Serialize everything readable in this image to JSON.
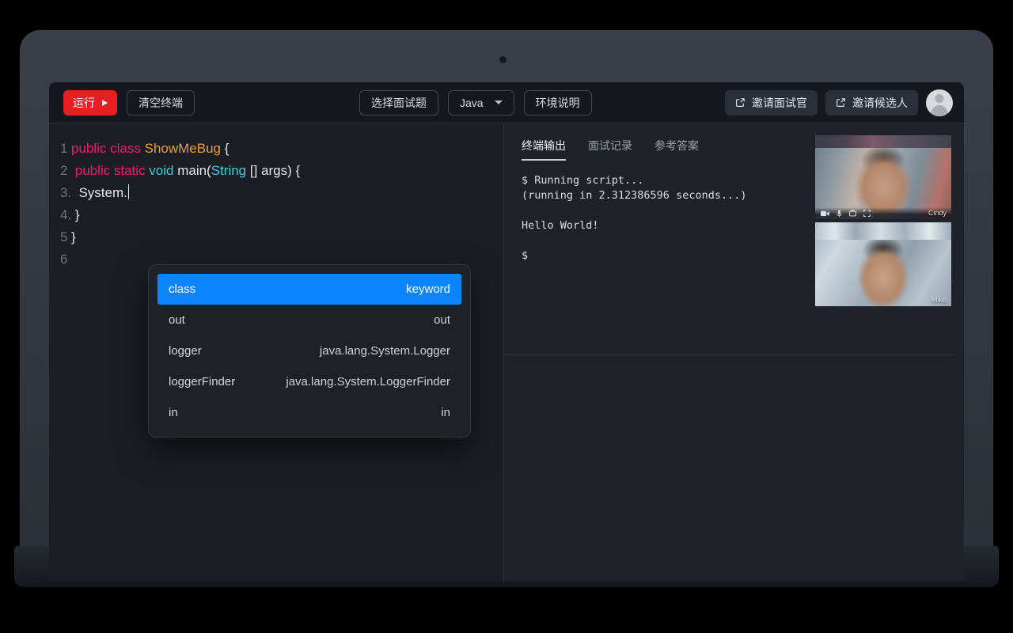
{
  "toolbar": {
    "run_label": "运行",
    "clear_terminal_label": "清空终端",
    "select_question_label": "选择面试题",
    "language_value": "Java",
    "env_note_label": "环境说明",
    "invite_interviewer_label": "邀请面试官",
    "invite_candidate_label": "邀请候选人"
  },
  "editor": {
    "lines": [
      {
        "no": "1",
        "tokens": [
          {
            "t": "public ",
            "c": "k-pink"
          },
          {
            "t": "class ",
            "c": "k-pink"
          },
          {
            "t": "ShowMeBug ",
            "c": "k-orange"
          },
          {
            "t": "{",
            "c": "ctext"
          }
        ]
      },
      {
        "no": "2",
        "tokens": [
          {
            "t": " ",
            "c": "ctext"
          },
          {
            "t": "public ",
            "c": "k-pink"
          },
          {
            "t": "static ",
            "c": "k-pink"
          },
          {
            "t": "void ",
            "c": "k-cyan"
          },
          {
            "t": "main(",
            "c": "ctext"
          },
          {
            "t": "String",
            "c": "k-cyan"
          },
          {
            "t": " [] args) {",
            "c": "ctext"
          }
        ]
      },
      {
        "no": "3.",
        "tokens": [
          {
            "t": "  System.",
            "c": "ctext"
          }
        ],
        "caret": true
      },
      {
        "no": "4.",
        "tokens": [
          {
            "t": " }",
            "c": "ctext"
          }
        ]
      },
      {
        "no": "5",
        "tokens": [
          {
            "t": "}",
            "c": "ctext"
          }
        ]
      },
      {
        "no": "6",
        "tokens": []
      }
    ]
  },
  "autocomplete": {
    "items": [
      {
        "label": "class",
        "detail": "keyword",
        "selected": true
      },
      {
        "label": "out",
        "detail": "out",
        "selected": false
      },
      {
        "label": "logger",
        "detail": "java.lang.System.Logger",
        "selected": false
      },
      {
        "label": "loggerFinder",
        "detail": "java.lang.System.LoggerFinder",
        "selected": false
      },
      {
        "label": "in",
        "detail": "in",
        "selected": false
      }
    ]
  },
  "right_panel": {
    "tabs": [
      {
        "label": "终端输出",
        "active": true
      },
      {
        "label": "面试记录",
        "active": false
      },
      {
        "label": "参考答案",
        "active": false
      }
    ],
    "terminal_lines": [
      "$ Running script...",
      "(running in 2.312386596 seconds...)",
      "",
      "Hello World!",
      "",
      "$"
    ]
  },
  "video": {
    "participants": [
      {
        "name": "Cindy",
        "controls": [
          "camera-icon",
          "mic-icon",
          "screen-share-icon",
          "fullscreen-icon"
        ]
      },
      {
        "name": "Mike",
        "controls": [
          "fullscreen-icon"
        ]
      }
    ]
  },
  "colors": {
    "accent_run": "#e81f23",
    "accent_select": "#0a84ff",
    "screen_bg": "#1c1f25",
    "toolbar_bg": "#16181d"
  }
}
